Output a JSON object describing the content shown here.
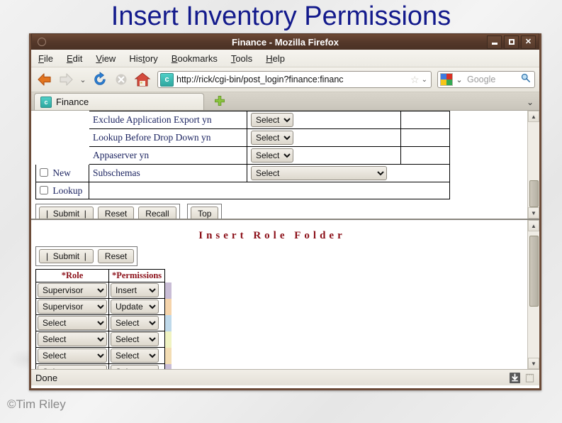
{
  "slide": {
    "title": "Insert Inventory Permissions",
    "copyright": "©Tim Riley"
  },
  "browser": {
    "window_title": "Finance - Mozilla Firefox",
    "window_controls": {
      "minimize": "_",
      "maximize": "□",
      "close": "✕"
    },
    "menu": [
      "File",
      "Edit",
      "View",
      "History",
      "Bookmarks",
      "Tools",
      "Help"
    ],
    "toolbar": {
      "back": "Back",
      "forward": "Forward",
      "history_dropdown": "⌄",
      "reload": "Reload",
      "stop": "Stop",
      "home": "Home"
    },
    "url_bar": {
      "favicon_glyph": "c",
      "value": "http://rick/cgi-bin/post_login?finance:financ",
      "bookmark_star": "☆",
      "dropdown": "⌄"
    },
    "search_bar": {
      "engine": "Google",
      "engine_dropdown": "⌄",
      "placeholder": "Google",
      "search_glyph": "🔍"
    },
    "tabs": [
      {
        "label": "Finance",
        "favicon_glyph": "c"
      }
    ],
    "new_tab_label": "+",
    "tab_list_chevron": "⌄",
    "status": {
      "text": "Done",
      "download_icon": "⬇",
      "notes_icon": "▤"
    }
  },
  "top_frame": {
    "rows": [
      {
        "checkbox": "",
        "checked": false,
        "label": "Exclude Application Export yn",
        "control": "select",
        "value": "Select",
        "width": "small"
      },
      {
        "checkbox": "",
        "checked": false,
        "label": "Lookup Before Drop Down yn",
        "control": "select",
        "value": "Select",
        "width": "small"
      },
      {
        "checkbox": "",
        "checked": false,
        "label": "Appaserver yn",
        "control": "select",
        "value": "Select",
        "width": "small"
      },
      {
        "checkbox": "New",
        "checked": false,
        "label": "Subschemas",
        "control": "select",
        "value": "Select",
        "width": "wide"
      },
      {
        "checkbox": "Lookup",
        "checked": false,
        "label": "",
        "control": "none",
        "value": "",
        "width": "none"
      }
    ],
    "select_options": [
      "Select"
    ],
    "buttons_primary": [
      "|  Submit  |",
      "Reset",
      "Recall"
    ],
    "buttons_secondary": [
      "Top"
    ]
  },
  "bottom_frame": {
    "heading": "Insert Role Folder",
    "buttons": [
      "|  Submit  |",
      "Reset"
    ],
    "table": {
      "headers": [
        "*Role",
        "*Permissions"
      ],
      "rows": [
        {
          "role": "Supervisor",
          "permission": "Insert",
          "strip_color": "#c9bdd6"
        },
        {
          "role": "Supervisor",
          "permission": "Update",
          "strip_color": "#f5d4ab"
        },
        {
          "role": "Select",
          "permission": "Select",
          "strip_color": "#bfd9ea"
        },
        {
          "role": "Select",
          "permission": "Select",
          "strip_color": "#f0f3c2"
        },
        {
          "role": "Select",
          "permission": "Select",
          "strip_color": "#f3ddb4"
        },
        {
          "role": "Select",
          "permission": "Select",
          "strip_color": "#c9bdd6"
        }
      ],
      "role_options": [
        "Select",
        "Supervisor"
      ],
      "permission_options": [
        "Select",
        "Insert",
        "Update"
      ]
    }
  },
  "colors": {
    "title_blue": "#131a8c",
    "heading_red": "#8b0f18",
    "form_label_blue": "#1c2461",
    "chrome_brown": "#55382a"
  }
}
